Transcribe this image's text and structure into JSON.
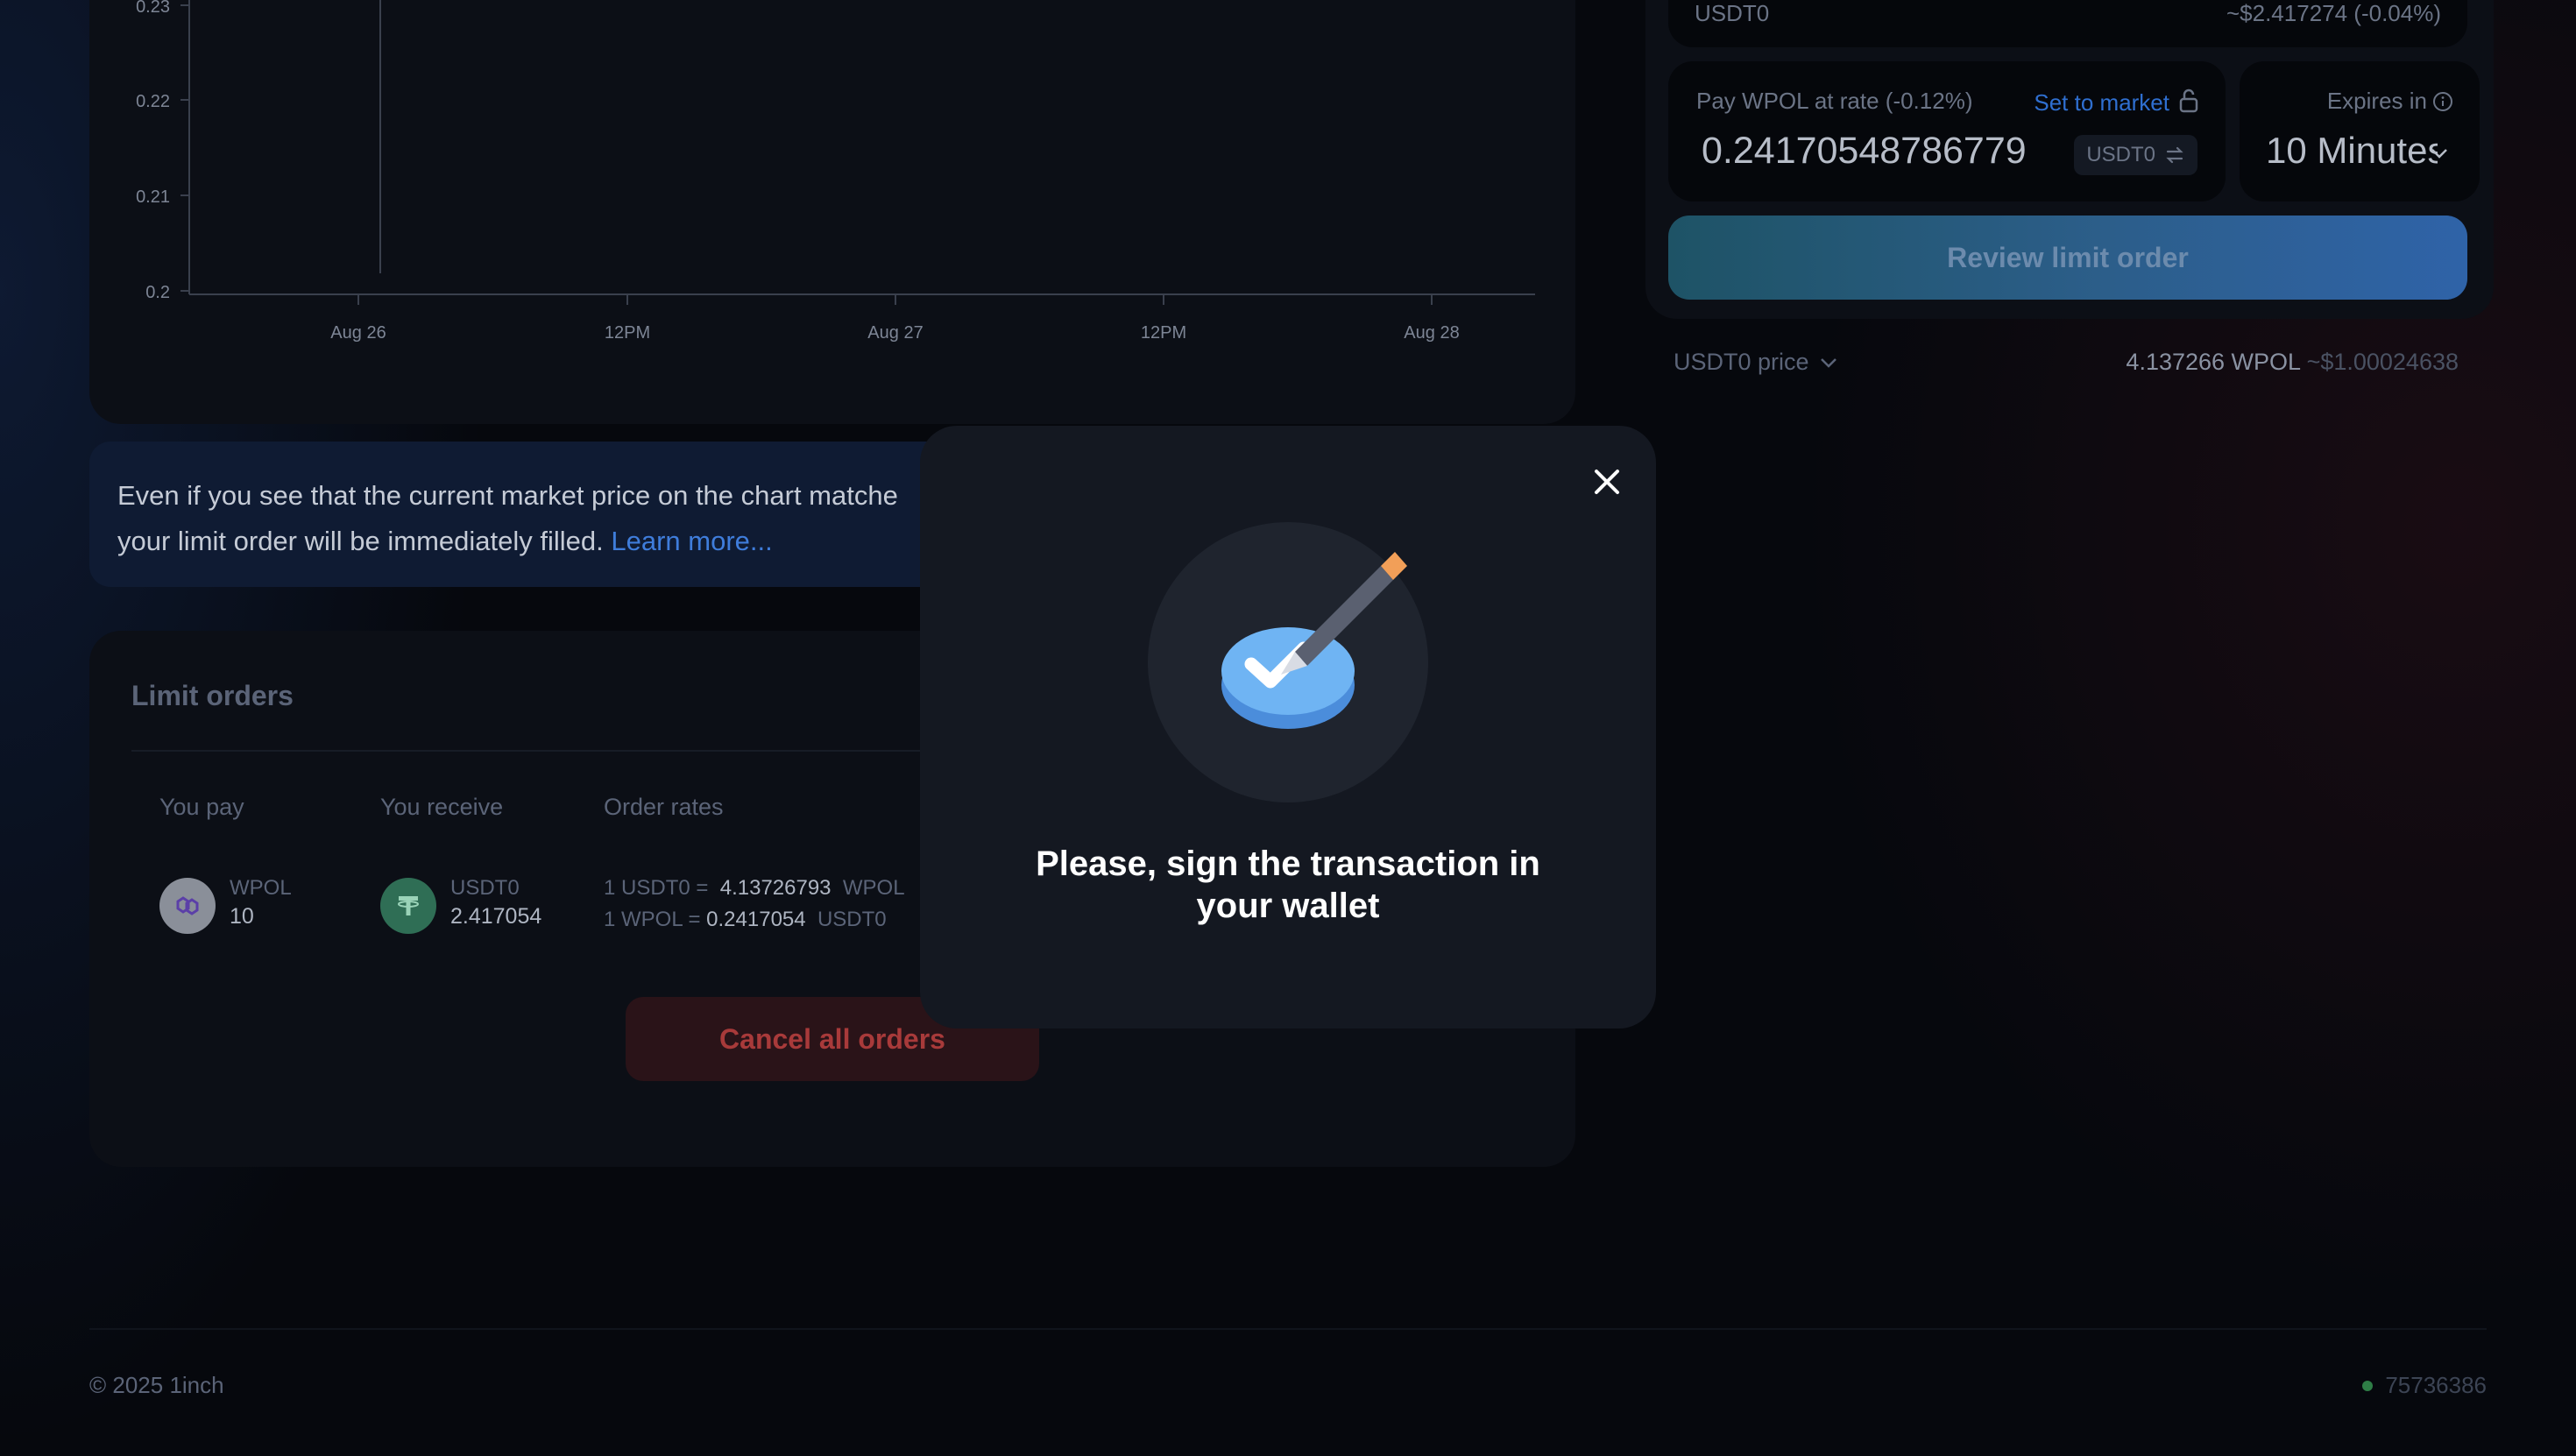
{
  "chart": {
    "y_ticks": [
      "0.23",
      "0.22",
      "0.21",
      "0.2"
    ],
    "x_ticks": [
      "Aug 26",
      "12PM",
      "Aug 27",
      "12PM",
      "Aug 28"
    ]
  },
  "info_banner": {
    "line1": "Even if you see that the current market price on the chart matche",
    "line2": "your limit order will be immediately filled.",
    "link": "Learn more..."
  },
  "limit_orders": {
    "title": "Limit orders",
    "columns": [
      "You pay",
      "You receive",
      "Order rates"
    ],
    "rows": [
      {
        "pay_token": "WPOL",
        "pay_amount": "10",
        "receive_token": "USDT0",
        "receive_amount": "2.417054",
        "rate1_prefix": "1 USDT0 =",
        "rate1_value": "4.13726793",
        "rate1_token": "WPOL",
        "rate2_prefix": "1 WPOL =",
        "rate2_value": "0.2417054",
        "rate2_token": "USDT0"
      }
    ],
    "cancel_label": "Cancel all orders"
  },
  "order_form": {
    "receive_token": "USDT0",
    "receive_usd": "~$2.417274  (-0.04%)",
    "rate_label": "Pay WPOL at rate (-0.12%)",
    "set_market": "Set to market",
    "rate_value": "0.24170548786779",
    "rate_token": "USDT0",
    "expires_label": "Expires in",
    "expires_value": "10 Minutes",
    "review_label": "Review limit order",
    "price_label": "USDT0 price",
    "price_value": "4.137266 WPOL",
    "price_usd": "~$1.00024638"
  },
  "footer": {
    "copyright": "© 2025 1inch",
    "block": "75736386"
  },
  "modal": {
    "message": "Please, sign the transaction in your wallet"
  },
  "colors": {
    "accent_link": "#3f7ddb",
    "danger": "#a83a3a",
    "status_ok": "#2e7d46"
  }
}
